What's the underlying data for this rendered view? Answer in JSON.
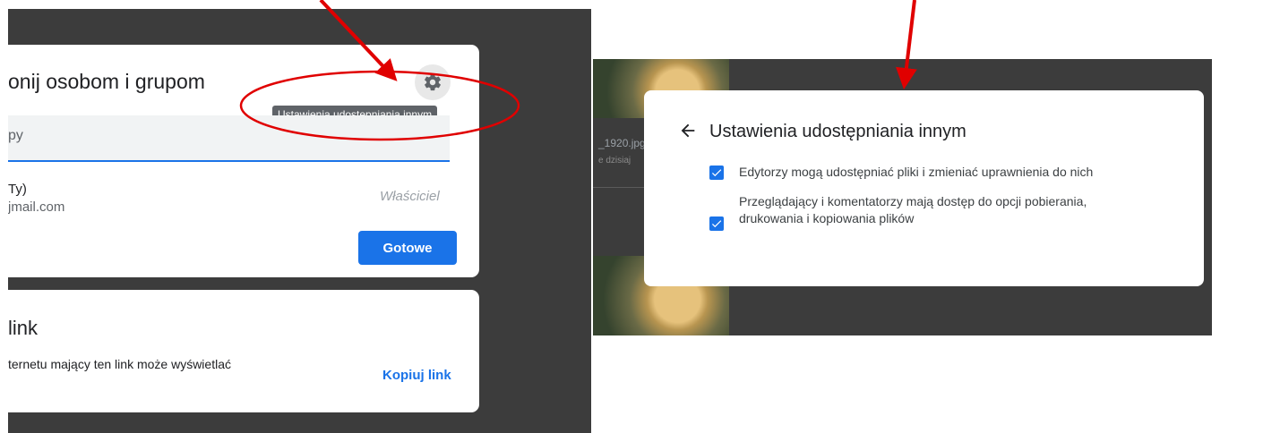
{
  "left_panel": {
    "share_dialog": {
      "title": "onij osobom i grupom",
      "gear_icon": "gear-icon",
      "tooltip": "Ustawienia udostępniania innym",
      "input_placeholder": "py",
      "user": {
        "name": "Ty)",
        "email": "jmail.com",
        "role": "Właściciel"
      },
      "done_button": "Gotowe"
    },
    "link_card": {
      "title": "link",
      "description": "ternetu mający ten link może wyświetlać",
      "copy_button": "Kopiuj link"
    }
  },
  "right_panel": {
    "background_file": {
      "name": "_1920.jpg",
      "date": "e dzisiaj"
    },
    "settings_dialog": {
      "back_icon": "arrow-back-icon",
      "title": "Ustawienia udostępniania innym",
      "options": [
        {
          "checked": true,
          "label": "Edytorzy mogą udostępniać pliki i zmieniać uprawnienia do nich"
        },
        {
          "checked": true,
          "label": "Przeglądający i komentatorzy mają dostęp do opcji pobierania, drukowania i kopiowania plików"
        }
      ]
    }
  },
  "annotations": {
    "arrow_color": "#e00000",
    "circle_color": "#e00000"
  },
  "colors": {
    "accent": "#1a73e8",
    "backdrop": "#3c3c3c",
    "tooltip_bg": "#5f6368"
  }
}
